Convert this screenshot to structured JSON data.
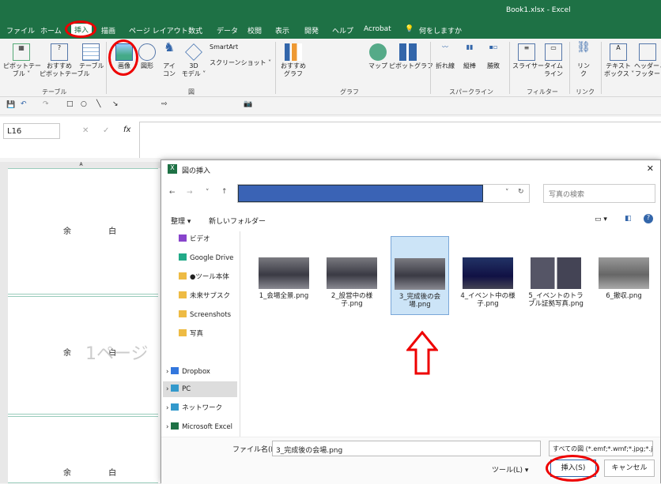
{
  "window": {
    "title": "Book1.xlsx  -  Excel"
  },
  "tabs": [
    "ファイル",
    "ホーム",
    "挿入",
    "描画",
    "ページ レイアウト",
    "数式",
    "データ",
    "校閲",
    "表示",
    "開発",
    "ヘルプ",
    "Acrobat",
    "何をしますか"
  ],
  "ribbon": {
    "pivot": "ピボットテー\nブル ˅",
    "recpivot": "おすすめ\nピボットテーブル",
    "table": "テーブル",
    "picture": "画像",
    "shapes": "図形",
    "icons": "アイ\nコン",
    "model": "3D\nモデル ˅",
    "smartart": "SmartArt",
    "screenshot": "スクリーンショット ˅",
    "recchart": "おすすめ\nグラフ",
    "map": "マップ",
    "pivotchart": "ピボットグラフ",
    "line": "折れ線",
    "column": "縦棒",
    "winloss": "勝敗",
    "slicer": "スライサー",
    "timeline": "タイム\nライン",
    "link": "リン\nク",
    "textbox": "テキスト\nボックス ˅",
    "headerfooter": "ヘッダーと\nフッター",
    "groups": {
      "table": "テーブル",
      "illust": "図",
      "chart": "グラフ",
      "spark": "スパークライン",
      "filter": "フィルター",
      "link": "リンク"
    }
  },
  "formula": {
    "namebox": "L16",
    "fx": "fx",
    "cancel": "✕",
    "enter": "✓"
  },
  "sheet": {
    "col_a": "A",
    "margin_text": "余  白",
    "watermark": "1ページ"
  },
  "dialog": {
    "title": "図の挿入",
    "search_placeholder": "写真の検索",
    "organize": "整理 ▾",
    "newfolder": "新しいフォルダー",
    "nav": [
      "ビデオ",
      "Google Drive",
      "●ツール本体",
      "未来サブスク",
      "Screenshots",
      "写真",
      "Dropbox",
      "PC",
      "ネットワーク",
      "Microsoft Excel"
    ],
    "files": [
      "1_会場全景.png",
      "2_設営中の様子.png",
      "3_完成後の会場.png",
      "4_イベント中の様子.png",
      "5_イベントのトラブル証拠写真.png",
      "6_撤収.png"
    ],
    "filename_label": "ファイル名(N):",
    "filename": "3_完成後の会場.png",
    "filetype": "すべての図 (*.emf;*.wmf;*.jpg;*.jp",
    "tools": "ツール(L)  ▾",
    "insert": "挿入(S)",
    "cancel": "キャンセル"
  },
  "colors": {
    "excel_green": "#1e7145",
    "highlight": "#e00000"
  }
}
